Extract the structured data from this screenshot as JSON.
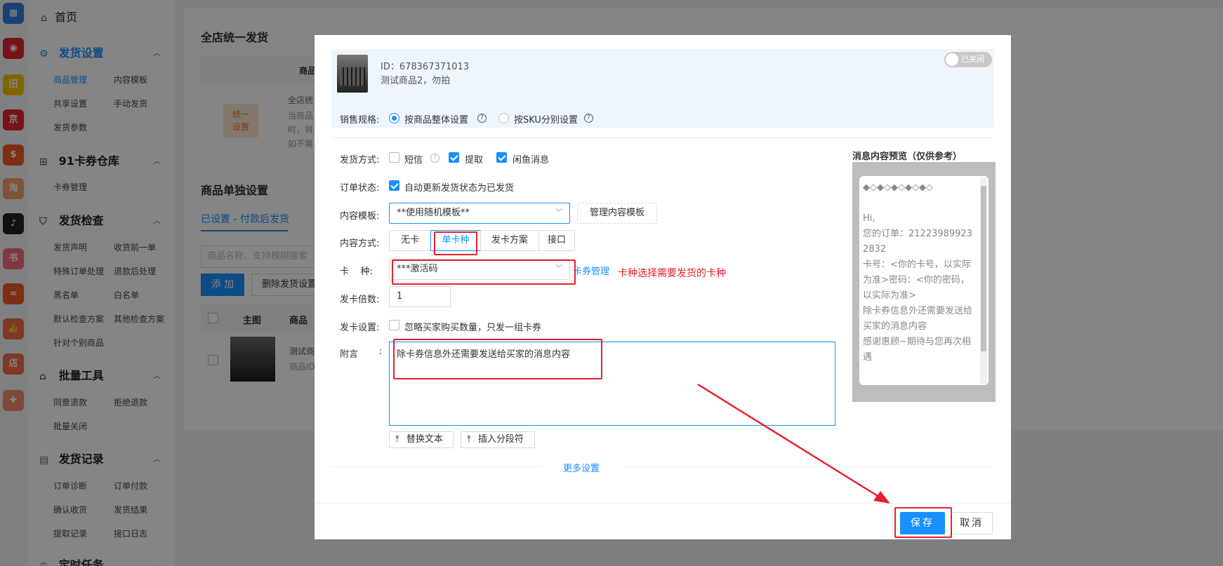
{
  "rail": {
    "icons": [
      {
        "name": "grid-app-icon",
        "glyph": "▦",
        "color": "#2d7be0"
      },
      {
        "name": "app-red-icon",
        "glyph": "◉",
        "color": "#e0262f"
      },
      {
        "name": "app-yellow-icon",
        "glyph": "田",
        "color": "#f3c200"
      },
      {
        "name": "jd-icon",
        "glyph": "京",
        "color": "#e0262f"
      },
      {
        "name": "shop-bag-icon",
        "glyph": "$",
        "color": "#f0582a"
      },
      {
        "name": "taobao-icon",
        "glyph": "淘",
        "color": "#f5a06a"
      },
      {
        "name": "tiktok-icon",
        "glyph": "♪",
        "color": "#222222"
      },
      {
        "name": "xiaohongshu-icon",
        "glyph": "书",
        "color": "#f36b7a"
      },
      {
        "name": "app-orange-icon",
        "glyph": "∞",
        "color": "#f0582a"
      },
      {
        "name": "thumb-up-icon",
        "glyph": "👍",
        "color": "#f36b4a"
      },
      {
        "name": "dian-icon",
        "glyph": "店",
        "color": "#f36b4a"
      },
      {
        "name": "app-gift-icon",
        "glyph": "✚",
        "color": "#f58a6a"
      }
    ]
  },
  "sidebar": {
    "home": "首页",
    "groups": [
      {
        "title": "发货设置",
        "items": [
          "商品管理",
          "内容模板",
          "共享设置",
          "手动发货",
          "发货参数"
        ]
      },
      {
        "title": "91卡券仓库",
        "items": [
          "卡券管理"
        ]
      },
      {
        "title": "发货检查",
        "items": [
          "发货声明",
          "收货前一单",
          "特殊订单处理",
          "退款后处理",
          "黑名单",
          "白名单",
          "默认检查方案",
          "其他检查方案",
          "针对个别商品"
        ]
      },
      {
        "title": "批量工具",
        "items": [
          "同意退款",
          "拒绝退款",
          "批量关闭"
        ]
      },
      {
        "title": "发货记录",
        "items": [
          "订单诊断",
          "订单付款",
          "确认收货",
          "发货结果",
          "提取记录",
          "接口日志"
        ]
      },
      {
        "title": "定时任务",
        "items": []
      }
    ]
  },
  "background": {
    "section_title": "全店统一发货",
    "col_product": "商品",
    "unified_badge": "统一\n设置",
    "desc_lines": [
      "全店统",
      "当商品",
      "时，将",
      "如不需"
    ],
    "single_title": "商品单独设置",
    "tab_set": "已设置 - 付款后发货",
    "search_placeholder": "商品名称，支持模糊搜索",
    "add_btn": "添 加",
    "delete_btn": "删除发货设置",
    "col_main_image": "主图",
    "col_product2": "商品",
    "row_name": "测试商",
    "row_id": "商品ID"
  },
  "modal": {
    "item_id": "ID：678367371013",
    "item_name": "测试商品2，勿拍",
    "toggle_label": "已关闭",
    "sales_spec_label": "销售规格:",
    "spec_whole": "按商品整体设置",
    "spec_sku": "按SKU分别设置",
    "delivery_method_label": "发货方式:",
    "delivery_options": [
      {
        "label": "短信",
        "checked": false
      },
      {
        "label": "提取",
        "checked": true
      },
      {
        "label": "闲鱼消息",
        "checked": true
      }
    ],
    "order_status_label": "订单状态:",
    "order_status_option": "自动更新发货状态为已发货",
    "content_template_label": "内容模板:",
    "content_template_value": "**使用随机模板**",
    "manage_template_btn": "管理内容模板",
    "content_method_label": "内容方式:",
    "content_tabs": [
      "无卡",
      "单卡种",
      "发卡方案",
      "接口"
    ],
    "active_tab": "单卡种",
    "card_type_label": "卡    种:",
    "card_type_value": "***激活码",
    "card_manage_link": "卡券管理",
    "card_note": "卡种选择需要发货的卡种",
    "multiplier_label": "发卡倍数:",
    "multiplier_value": "1",
    "card_setting_label": "发卡设置:",
    "card_setting_option": "忽略买家购买数量，只发一组卡券",
    "note_label": "附言",
    "note_colon": ":",
    "note_value": "除卡券信息外还需要发送给买家的消息内容",
    "replace_text_btn": "替换文本",
    "insert_sep_btn": "插入分段符",
    "more_settings": "更多设置",
    "preview_title": "消息内容预览（仅供参考）",
    "preview_text": "◆◇◆◇◆◇◆◇◆◇\n\nHi,\n您的订单：212239899232832\n卡号：<你的卡号，以实际为准>密码：<你的密码，以实际为准>\n除卡券信息外还需要发送给买家的消息内容\n感谢惠顾~期待与您再次相遇\n\n◆◇◆◇◆◇◆◇◆◇",
    "save_btn": "保存",
    "cancel_btn": "取消"
  },
  "colors": {
    "accent": "#1890ff",
    "annotation_red": "#e8202a"
  }
}
